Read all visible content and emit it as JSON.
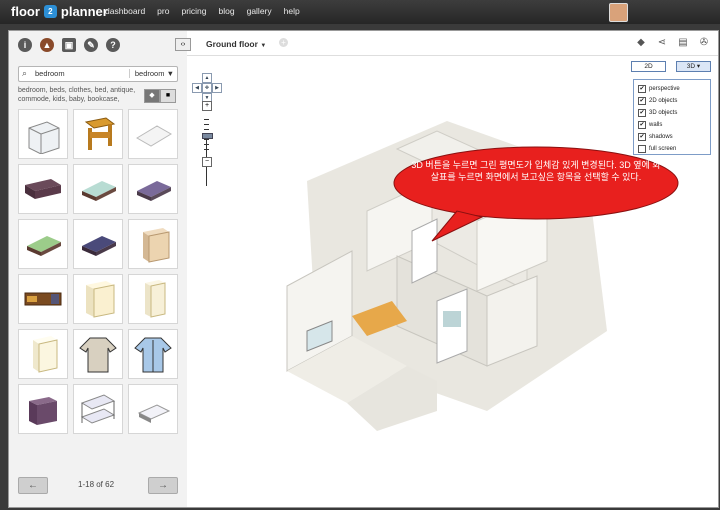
{
  "topnav": {
    "logo_left": "floor",
    "logo_mark": "2",
    "logo_right": "planner",
    "links": [
      "dashboard",
      "pro",
      "pricing",
      "blog",
      "gallery",
      "help"
    ]
  },
  "sidebar": {
    "tool_icons": [
      "info-icon",
      "furniture-icon",
      "photo-icon",
      "paint-icon",
      "help-icon"
    ],
    "search": {
      "value": "bedroom",
      "category": "bedroom",
      "category_caret": "▼"
    },
    "tags": "bedroom, beds, clothes, bed, antique, commode, kids, baby, bookcase,",
    "view_toggle": [
      "3d-view-icon",
      "2d-view-icon"
    ],
    "items": [
      {
        "name": "dresser-white"
      },
      {
        "name": "nightstand-wood"
      },
      {
        "name": "rug-white"
      },
      {
        "name": "chest-dark"
      },
      {
        "name": "bed-mint"
      },
      {
        "name": "bed-purple"
      },
      {
        "name": "bed-green"
      },
      {
        "name": "bed-navy"
      },
      {
        "name": "dresser-tall"
      },
      {
        "name": "tv-cabinet"
      },
      {
        "name": "wardrobe-cream"
      },
      {
        "name": "wardrobe-tall"
      },
      {
        "name": "cabinet-white"
      },
      {
        "name": "sweater"
      },
      {
        "name": "shirt"
      },
      {
        "name": "dresser-purple"
      },
      {
        "name": "bunk-bed"
      },
      {
        "name": "single-bed"
      }
    ],
    "pager": {
      "prev": "←",
      "next": "→",
      "text": "1-18 of 62"
    }
  },
  "main": {
    "collapse": "‹›",
    "floor_name": "Ground floor",
    "floor_caret": "▼",
    "add_floor": "+",
    "toolbar_icons": [
      "eraser-icon",
      "share-icon",
      "print-icon",
      "wrench-icon"
    ],
    "view2d": "2D",
    "view3d": "3D ▾",
    "menu_3d": [
      {
        "label": "perspective",
        "checked": true
      },
      {
        "label": "2D objects",
        "checked": true
      },
      {
        "label": "3D objects",
        "checked": true
      },
      {
        "label": "walls",
        "checked": true
      },
      {
        "label": "shadows",
        "checked": true
      },
      {
        "label": "full screen",
        "checked": false
      }
    ],
    "callout": "3D 버튼을 누르면 그린 평면도가 입체감 있게 변경된다. 3D 옆에 화살표를 누르면 화면에서 보고싶은 항목을 선택할 수 있다.",
    "colors": {
      "callout_fill": "#e8201e",
      "walls": "#f4f3ef",
      "floor_dark": "#d9d6cc",
      "menu_border": "#7d9cc7"
    }
  }
}
